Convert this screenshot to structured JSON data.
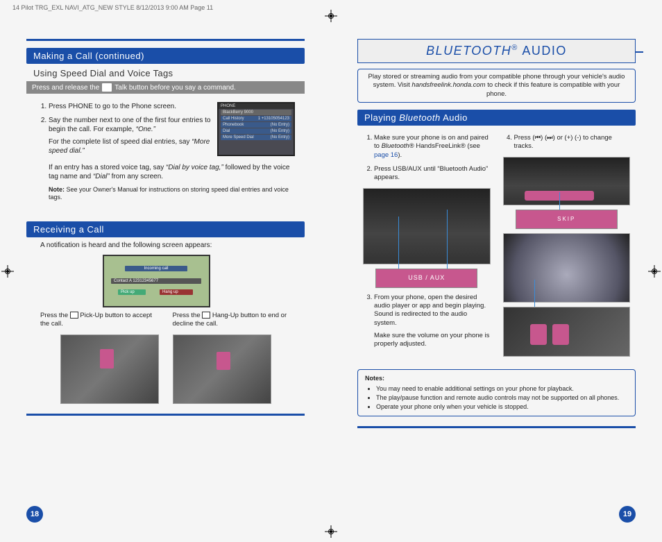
{
  "print_header": "14 Pilot TRG_EXL NAVI_ATG_NEW STYLE  8/12/2013  9:00 AM  Page 11",
  "left": {
    "sec1_title": "Making a Call (continued)",
    "subhead": "Using Speed Dial and Voice Tags",
    "graybar_pre": "Press and release the",
    "graybar_post": "Talk button before you say a command.",
    "step1": "Press PHONE to go to the Phone screen.",
    "step2": "Say the number next to one of the first four entries to begin the call. For example, ",
    "step2_em": "“One.”",
    "step2_after": "For the complete list of speed dial entries, say ",
    "step2_after_em": "“More speed dial.”",
    "paragraph": "If an entry has a stored voice tag, say ",
    "paragraph_em1": "“Dial by voice tag,”",
    "paragraph_mid": " followed by the voice tag name and ",
    "paragraph_em2": "“Dial”",
    "paragraph_end": " from any screen.",
    "note_b": "Note:",
    "note_text": " See your Owner's Manual for instructions on storing speed dial entries and voice tags.",
    "phone_top": "PHONE",
    "phone_device": "BlackBerry 9000",
    "phone_r1a": "Call History",
    "phone_r1b": "1 +13105054123",
    "phone_r2a": "Phonebook",
    "phone_r2b": "(No Entry)",
    "phone_r3a": "Dial",
    "phone_r3b": "(No Entry)",
    "phone_r4a": "More Speed Dial",
    "phone_r4b": "(No Entry)",
    "sec2_title": "Receiving a Call",
    "notif": "A notification is heard and the following screen appears:",
    "nav_incoming": "Incoming call",
    "nav_contact": "Contact A        12312345677",
    "nav_pickup": "Pick up",
    "nav_hangup": "Hang up",
    "pickup_pre": "Press the ",
    "pickup_post": " Pick-Up button to accept the call.",
    "hangup_pre": "Press the ",
    "hangup_post": " Hang-Up button to end or decline the call.",
    "page_num": "18"
  },
  "right": {
    "title_ital": "BLUETOOTH",
    "title_reg": "®",
    "title_rest": " AUDIO",
    "intro1": "Play stored or streaming audio from your compatible phone through your vehicle's audio system. Visit ",
    "intro_em": "handsfreelink.honda.com",
    "intro2": " to check if this feature is compatible with your phone.",
    "sec_title_pre": "Playing ",
    "sec_title_ital": "Bluetooth",
    "sec_title_post": " Audio",
    "s1_pre": "Make sure your phone is on and paired to ",
    "s1_ital": "Bluetooth",
    "s1_mid": "® HandsFreeLink® (see ",
    "s1_link": "page 16",
    "s1_end": ").",
    "s2": "Press USB/AUX until “Bluetooth Audio” appears.",
    "s3a": "From your phone, open the desired audio player or app and begin playing. Sound is redirected to the audio system.",
    "s3b": "Make sure the volume on your phone is properly adjusted.",
    "s4": "Press (⏮) (⏭) or (+) (-) to change tracks.",
    "usb_label": "USB / AUX",
    "skip_label": "SKIP",
    "notes_head": "Notes:",
    "n1": "You may need to enable additional settings on your phone for playback.",
    "n2": "The play/pause function and remote audio controls may not be supported on all phones.",
    "n3": "Operate your phone only when your vehicle is stopped.",
    "page_num": "19"
  }
}
